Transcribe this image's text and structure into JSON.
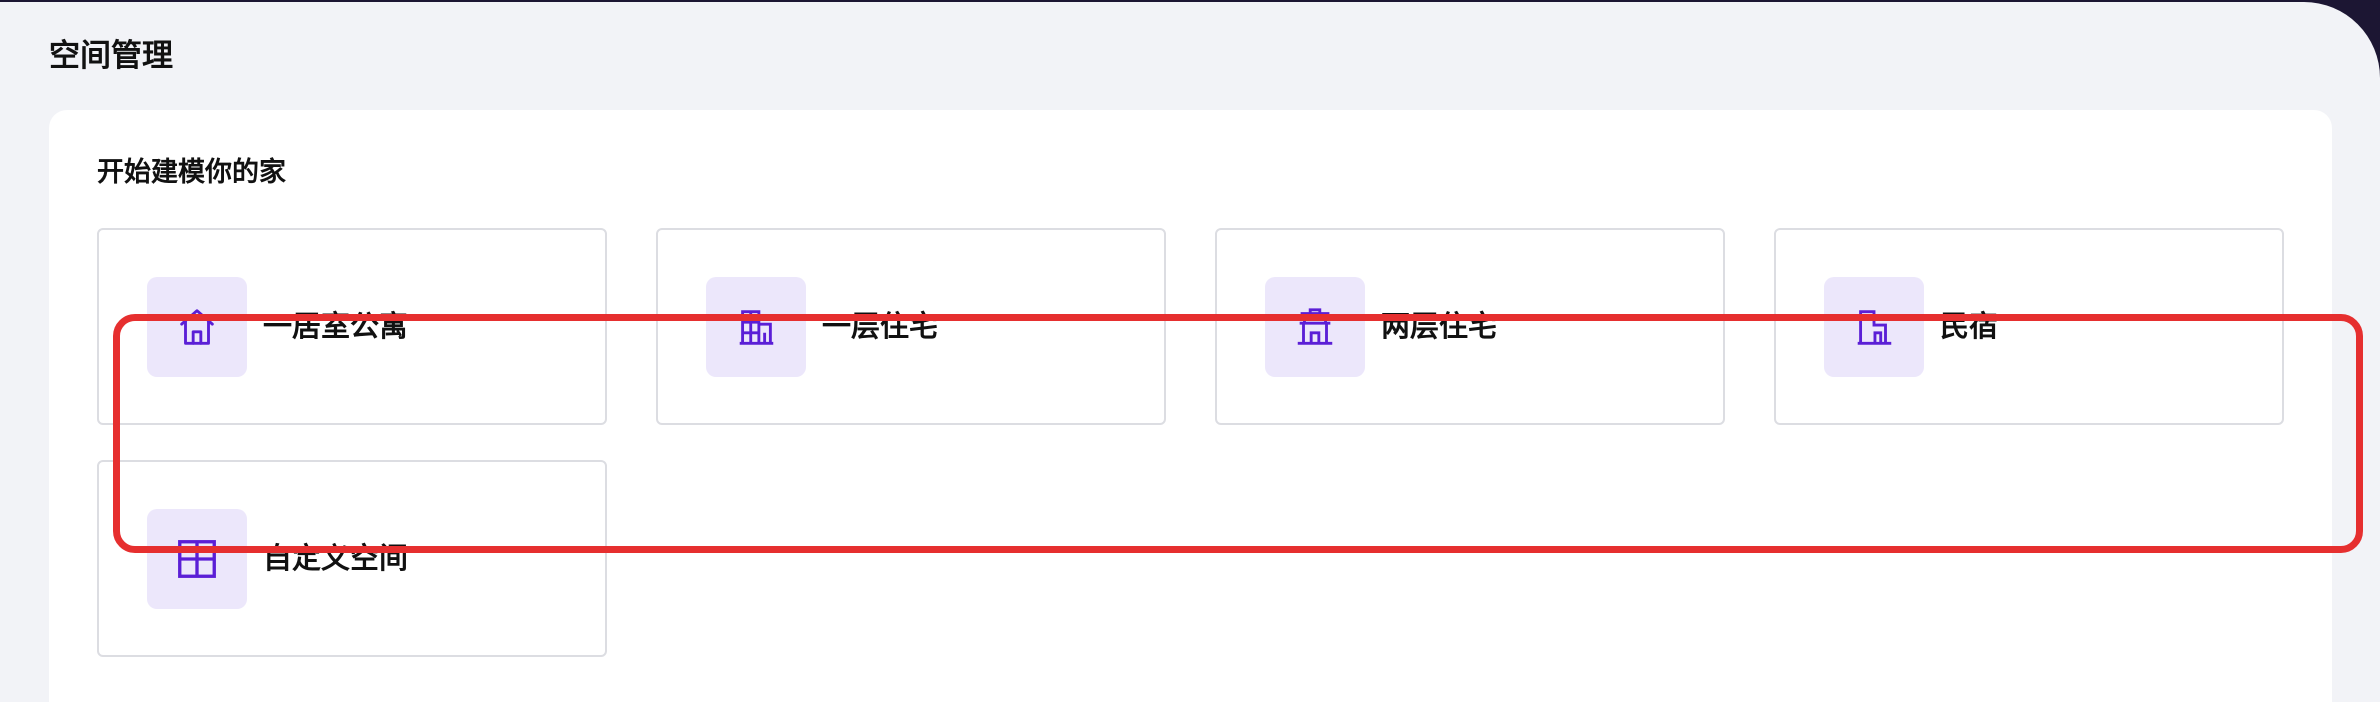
{
  "page": {
    "title": "空间管理"
  },
  "section": {
    "title": "开始建模你的家"
  },
  "templates": [
    {
      "label": "一居室公寓",
      "icon": "house-icon"
    },
    {
      "label": "一层住宅",
      "icon": "building-icon"
    },
    {
      "label": "两层住宅",
      "icon": "two-story-house-icon"
    },
    {
      "label": "民宿",
      "icon": "guesthouse-icon"
    },
    {
      "label": "自定义空间",
      "icon": "grid-icon"
    }
  ],
  "colors": {
    "icon_stroke": "#5b1fd6",
    "icon_tile": "#ece7fb",
    "highlight": "#e62f2f",
    "background": "#f2f3f7"
  }
}
